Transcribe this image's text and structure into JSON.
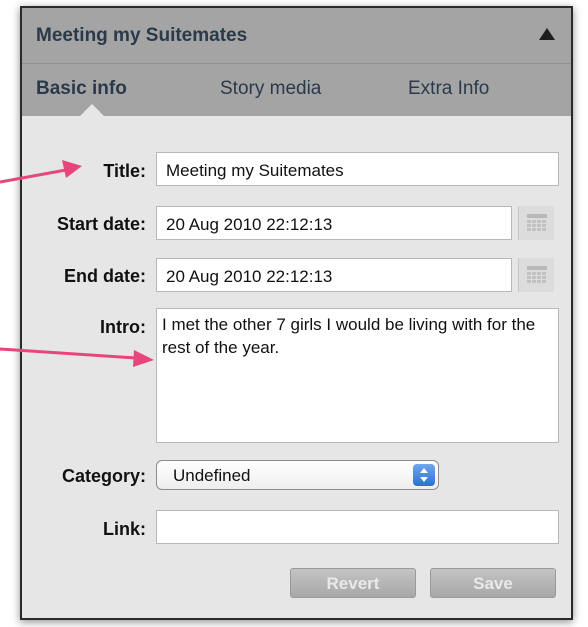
{
  "panel": {
    "title": "Meeting my Suitemates",
    "collapse_icon": "triangle-up-icon"
  },
  "tabs": [
    {
      "label": "Basic info",
      "active": true
    },
    {
      "label": "Story media",
      "active": false
    },
    {
      "label": "Extra Info",
      "active": false
    }
  ],
  "form": {
    "title_label": "Title:",
    "title_value": "Meeting my Suitemates",
    "start_label": "Start date:",
    "start_value": "20 Aug 2010 22:12:13",
    "end_label": "End date:",
    "end_value": "20 Aug 2010 22:12:13",
    "calendar_icon": "calendar-grid-icon",
    "intro_label": "Intro:",
    "intro_value": "I met the other 7 girls I would be living with for the rest of the year.",
    "category_label": "Category:",
    "category_value": "Undefined",
    "link_label": "Link:",
    "link_value": ""
  },
  "buttons": {
    "revert": "Revert",
    "save": "Save"
  },
  "colors": {
    "header_bg": "#a4a4a4",
    "panel_bg": "#e6e6e6",
    "annotation_arrow": "#e8457c"
  }
}
